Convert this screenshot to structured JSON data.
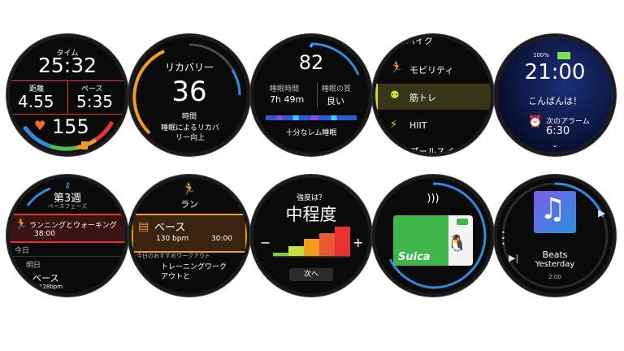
{
  "w1": {
    "time_label": "タイム",
    "time_value": "25:32",
    "distance_label": "距離",
    "distance_value": "4.55",
    "pace_label": "ペース",
    "pace_value": "5:35",
    "heart_value": "155"
  },
  "w2": {
    "title": "リカバリー",
    "value": "36",
    "unit": "時間",
    "desc": "睡眠によるリカバリー向上",
    "ring_progress": 0.72
  },
  "w3": {
    "score": "82",
    "sleep_time_label": "睡眠時間",
    "sleep_time_value": "7h 49m",
    "sleep_quality_label": "睡眠の質",
    "sleep_quality_value": "良い",
    "summary": "十分なレム睡眠"
  },
  "w4": {
    "items": [
      "バイク",
      "モビリティ",
      "筋トレ",
      "HIIT",
      "プールスイム"
    ]
  },
  "w5": {
    "battery": "100%",
    "time": "21:00",
    "greeting": "こんばんは！",
    "alarm_label": "次のアラーム",
    "alarm_time": "6:30"
  },
  "w6": {
    "week": "第3週",
    "phase": "ベースフェーズ",
    "workout": "ランニングとウォーキング",
    "duration": "38:00",
    "today": "今日",
    "tomorrow": "明日",
    "next_workout": "ベース",
    "next_hr": "128bpm"
  },
  "w7": {
    "title": "ラン",
    "workout": "ベース",
    "hr": "130 bpm",
    "duration": "30:00",
    "recommend": "今日のおすすめワークアウト",
    "training": "トレーニングワークアウトと"
  },
  "w8": {
    "question": "強度は？",
    "level": "中程度",
    "minus": "−",
    "plus": "+",
    "next_button": "次へ",
    "bars": [
      1,
      2,
      3,
      4,
      5
    ],
    "selected": 3
  },
  "w9": {
    "card_text": "Suica"
  },
  "w10": {
    "title": "Beats",
    "subtitle": "Yesterday",
    "time": "2:00"
  },
  "colors": {
    "run_red": "#e8322f",
    "orange": "#f29b1d",
    "heart": "#ff6a2a",
    "accent_blue": "#2f8be0",
    "lime": "#c8e03a"
  }
}
